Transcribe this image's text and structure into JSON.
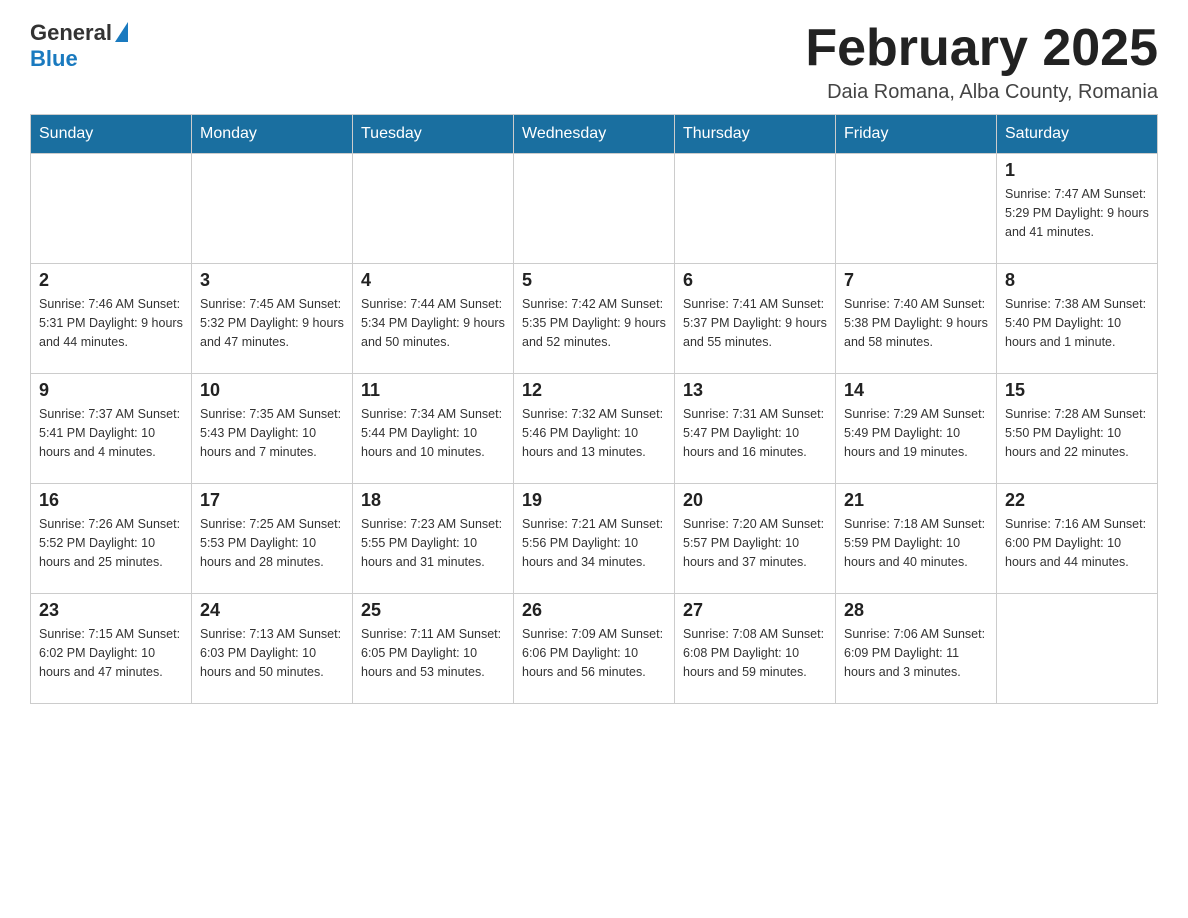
{
  "header": {
    "logo_general": "General",
    "logo_blue": "Blue",
    "title": "February 2025",
    "location": "Daia Romana, Alba County, Romania"
  },
  "days_of_week": [
    "Sunday",
    "Monday",
    "Tuesday",
    "Wednesday",
    "Thursday",
    "Friday",
    "Saturday"
  ],
  "weeks": [
    [
      {
        "day": "",
        "info": ""
      },
      {
        "day": "",
        "info": ""
      },
      {
        "day": "",
        "info": ""
      },
      {
        "day": "",
        "info": ""
      },
      {
        "day": "",
        "info": ""
      },
      {
        "day": "",
        "info": ""
      },
      {
        "day": "1",
        "info": "Sunrise: 7:47 AM\nSunset: 5:29 PM\nDaylight: 9 hours and 41 minutes."
      }
    ],
    [
      {
        "day": "2",
        "info": "Sunrise: 7:46 AM\nSunset: 5:31 PM\nDaylight: 9 hours and 44 minutes."
      },
      {
        "day": "3",
        "info": "Sunrise: 7:45 AM\nSunset: 5:32 PM\nDaylight: 9 hours and 47 minutes."
      },
      {
        "day": "4",
        "info": "Sunrise: 7:44 AM\nSunset: 5:34 PM\nDaylight: 9 hours and 50 minutes."
      },
      {
        "day": "5",
        "info": "Sunrise: 7:42 AM\nSunset: 5:35 PM\nDaylight: 9 hours and 52 minutes."
      },
      {
        "day": "6",
        "info": "Sunrise: 7:41 AM\nSunset: 5:37 PM\nDaylight: 9 hours and 55 minutes."
      },
      {
        "day": "7",
        "info": "Sunrise: 7:40 AM\nSunset: 5:38 PM\nDaylight: 9 hours and 58 minutes."
      },
      {
        "day": "8",
        "info": "Sunrise: 7:38 AM\nSunset: 5:40 PM\nDaylight: 10 hours and 1 minute."
      }
    ],
    [
      {
        "day": "9",
        "info": "Sunrise: 7:37 AM\nSunset: 5:41 PM\nDaylight: 10 hours and 4 minutes."
      },
      {
        "day": "10",
        "info": "Sunrise: 7:35 AM\nSunset: 5:43 PM\nDaylight: 10 hours and 7 minutes."
      },
      {
        "day": "11",
        "info": "Sunrise: 7:34 AM\nSunset: 5:44 PM\nDaylight: 10 hours and 10 minutes."
      },
      {
        "day": "12",
        "info": "Sunrise: 7:32 AM\nSunset: 5:46 PM\nDaylight: 10 hours and 13 minutes."
      },
      {
        "day": "13",
        "info": "Sunrise: 7:31 AM\nSunset: 5:47 PM\nDaylight: 10 hours and 16 minutes."
      },
      {
        "day": "14",
        "info": "Sunrise: 7:29 AM\nSunset: 5:49 PM\nDaylight: 10 hours and 19 minutes."
      },
      {
        "day": "15",
        "info": "Sunrise: 7:28 AM\nSunset: 5:50 PM\nDaylight: 10 hours and 22 minutes."
      }
    ],
    [
      {
        "day": "16",
        "info": "Sunrise: 7:26 AM\nSunset: 5:52 PM\nDaylight: 10 hours and 25 minutes."
      },
      {
        "day": "17",
        "info": "Sunrise: 7:25 AM\nSunset: 5:53 PM\nDaylight: 10 hours and 28 minutes."
      },
      {
        "day": "18",
        "info": "Sunrise: 7:23 AM\nSunset: 5:55 PM\nDaylight: 10 hours and 31 minutes."
      },
      {
        "day": "19",
        "info": "Sunrise: 7:21 AM\nSunset: 5:56 PM\nDaylight: 10 hours and 34 minutes."
      },
      {
        "day": "20",
        "info": "Sunrise: 7:20 AM\nSunset: 5:57 PM\nDaylight: 10 hours and 37 minutes."
      },
      {
        "day": "21",
        "info": "Sunrise: 7:18 AM\nSunset: 5:59 PM\nDaylight: 10 hours and 40 minutes."
      },
      {
        "day": "22",
        "info": "Sunrise: 7:16 AM\nSunset: 6:00 PM\nDaylight: 10 hours and 44 minutes."
      }
    ],
    [
      {
        "day": "23",
        "info": "Sunrise: 7:15 AM\nSunset: 6:02 PM\nDaylight: 10 hours and 47 minutes."
      },
      {
        "day": "24",
        "info": "Sunrise: 7:13 AM\nSunset: 6:03 PM\nDaylight: 10 hours and 50 minutes."
      },
      {
        "day": "25",
        "info": "Sunrise: 7:11 AM\nSunset: 6:05 PM\nDaylight: 10 hours and 53 minutes."
      },
      {
        "day": "26",
        "info": "Sunrise: 7:09 AM\nSunset: 6:06 PM\nDaylight: 10 hours and 56 minutes."
      },
      {
        "day": "27",
        "info": "Sunrise: 7:08 AM\nSunset: 6:08 PM\nDaylight: 10 hours and 59 minutes."
      },
      {
        "day": "28",
        "info": "Sunrise: 7:06 AM\nSunset: 6:09 PM\nDaylight: 11 hours and 3 minutes."
      },
      {
        "day": "",
        "info": ""
      }
    ]
  ]
}
